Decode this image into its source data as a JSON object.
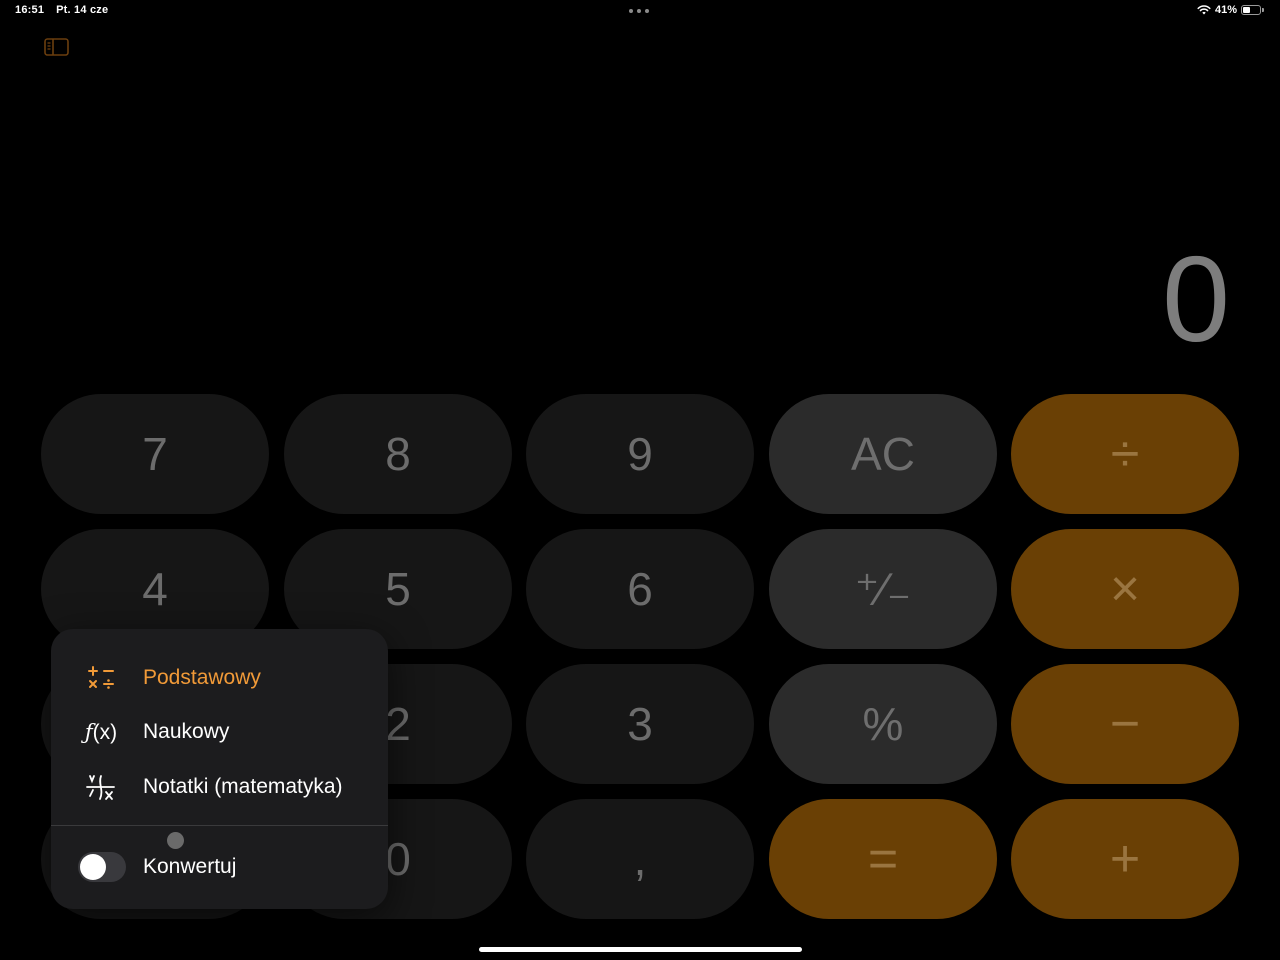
{
  "status_bar": {
    "time": "16:51",
    "date": "Pt. 14 cze",
    "battery_percent": "41%",
    "battery_level": 0.41
  },
  "display": {
    "value": "0"
  },
  "keypad": {
    "row1": [
      "7",
      "8",
      "9",
      "AC",
      "÷"
    ],
    "row2": [
      "4",
      "5",
      "6",
      "⁺∕₋",
      "×"
    ],
    "row3": [
      "",
      "2",
      "3",
      "%",
      "−"
    ],
    "row4": [
      "",
      "0",
      ",",
      "=",
      "+"
    ]
  },
  "menu": {
    "items": [
      {
        "label": "Podstawowy",
        "icon": "basic-operations-icon",
        "active": true
      },
      {
        "label": "Naukowy",
        "icon": "function-fx-icon",
        "active": false
      },
      {
        "label": "Notatki (matematyka)",
        "icon": "math-notes-icon",
        "active": false
      }
    ],
    "toggle": {
      "label": "Konwertuj",
      "on": false
    }
  },
  "colors": {
    "accent": "#f19a38",
    "operator_key": "#6a4005",
    "function_key": "#2b2b2b",
    "number_key": "#161616",
    "menu_bg": "#1c1c1e"
  }
}
